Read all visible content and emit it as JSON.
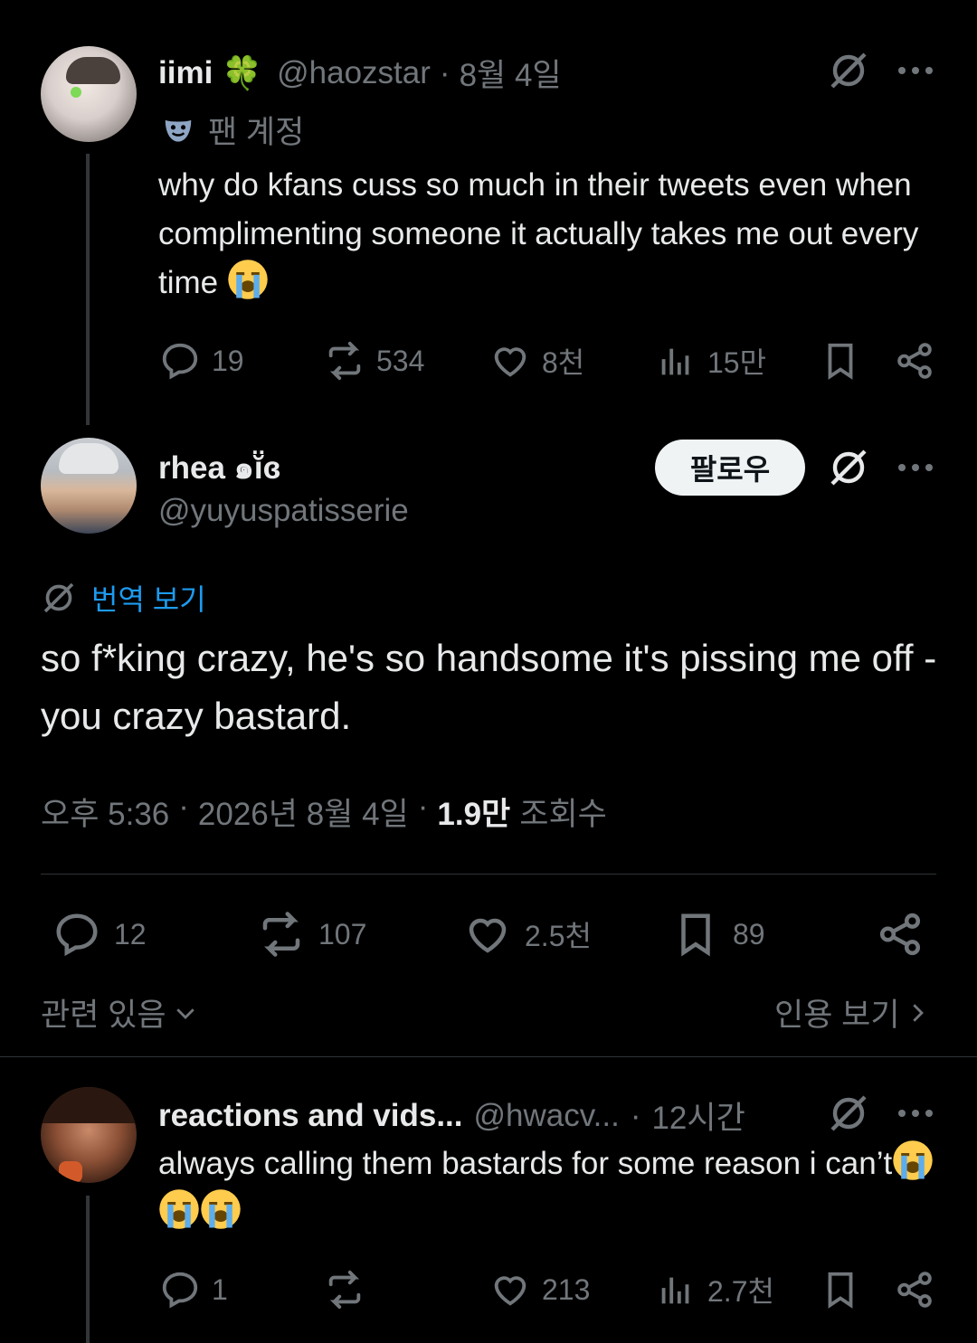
{
  "tweet1": {
    "display_name": "iimi",
    "name_emoji": "🍀",
    "handle": "@haozstar",
    "separator": "·",
    "date": "8월 4일",
    "fan_label": "팬 계정",
    "text": "why do kfans cuss so much in their tweets even when complimenting someone it actually takes me out every time",
    "text_emoji": "😭",
    "replies": "19",
    "reposts": "534",
    "likes": "8천",
    "views": "15만"
  },
  "main_tweet": {
    "display_name": "rhea ๑ĭ̈ɞ",
    "handle": "@yuyuspatisserie",
    "follow_label": "팔로우",
    "translate_label": "번역 보기",
    "text": "so f*king crazy, he's so handsome it's pissing me off - you crazy bastard.",
    "time": "오후 5:36",
    "separator": "·",
    "date": "2026년 8월 4일",
    "views_count": "1.9만",
    "views_label": "조회수",
    "replies": "12",
    "reposts": "107",
    "likes": "2.5천",
    "bookmarks": "89",
    "related_label": "관련 있음",
    "quotes_label": "인용 보기"
  },
  "tweet3": {
    "display_name": "reactions and vids...",
    "handle": "@hwacv...",
    "separator": "·",
    "time": "12시간",
    "text": "always calling them bastards for some reason i can’t",
    "replies": "1",
    "reposts": "",
    "likes": "213",
    "views": "2.7천"
  },
  "colors": {
    "background": "#000000",
    "text": "#e7e9ea",
    "secondary": "#71767b",
    "link": "#1d9bf0",
    "divider": "#2f3336"
  }
}
